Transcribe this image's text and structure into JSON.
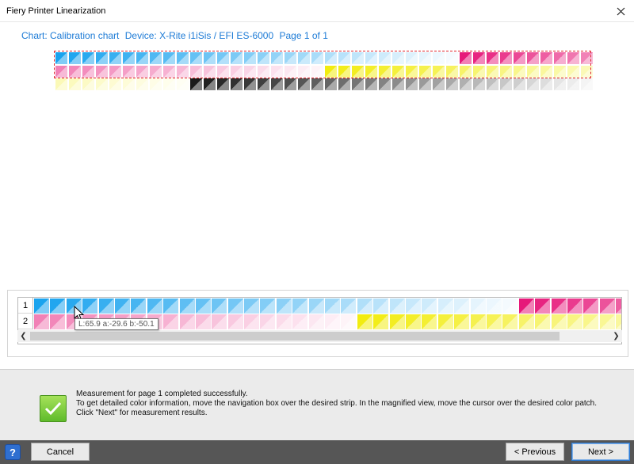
{
  "window": {
    "title": "Fiery Printer Linearization"
  },
  "chart_header": {
    "chart": "Chart: Calibration chart",
    "device": "Device: X-Rite i1iSis / EFI ES-6000",
    "page": "Page 1 of 1"
  },
  "magnifier": {
    "row_labels": [
      "1",
      "2"
    ],
    "tooltip": "L:65.9 a:-29.6 b:-50.1"
  },
  "status": {
    "lines": [
      "Measurement for page 1 completed successfully.",
      "To get detailed color information, move the navigation box over the desired strip. In the magnified view, move the cursor over the desired color patch.",
      "Click \"Next\" for measurement results."
    ]
  },
  "buttons": {
    "cancel": "Cancel",
    "previous": "< Previous",
    "next": "Next >",
    "help": "?"
  },
  "colors": {
    "cyan": "#1aa3ee",
    "magenta": "#e6197a",
    "yellow": "#f2ec10",
    "black": "#1a1a1a",
    "accent": "#1d7bd6",
    "nav_box": "#e0242c"
  }
}
